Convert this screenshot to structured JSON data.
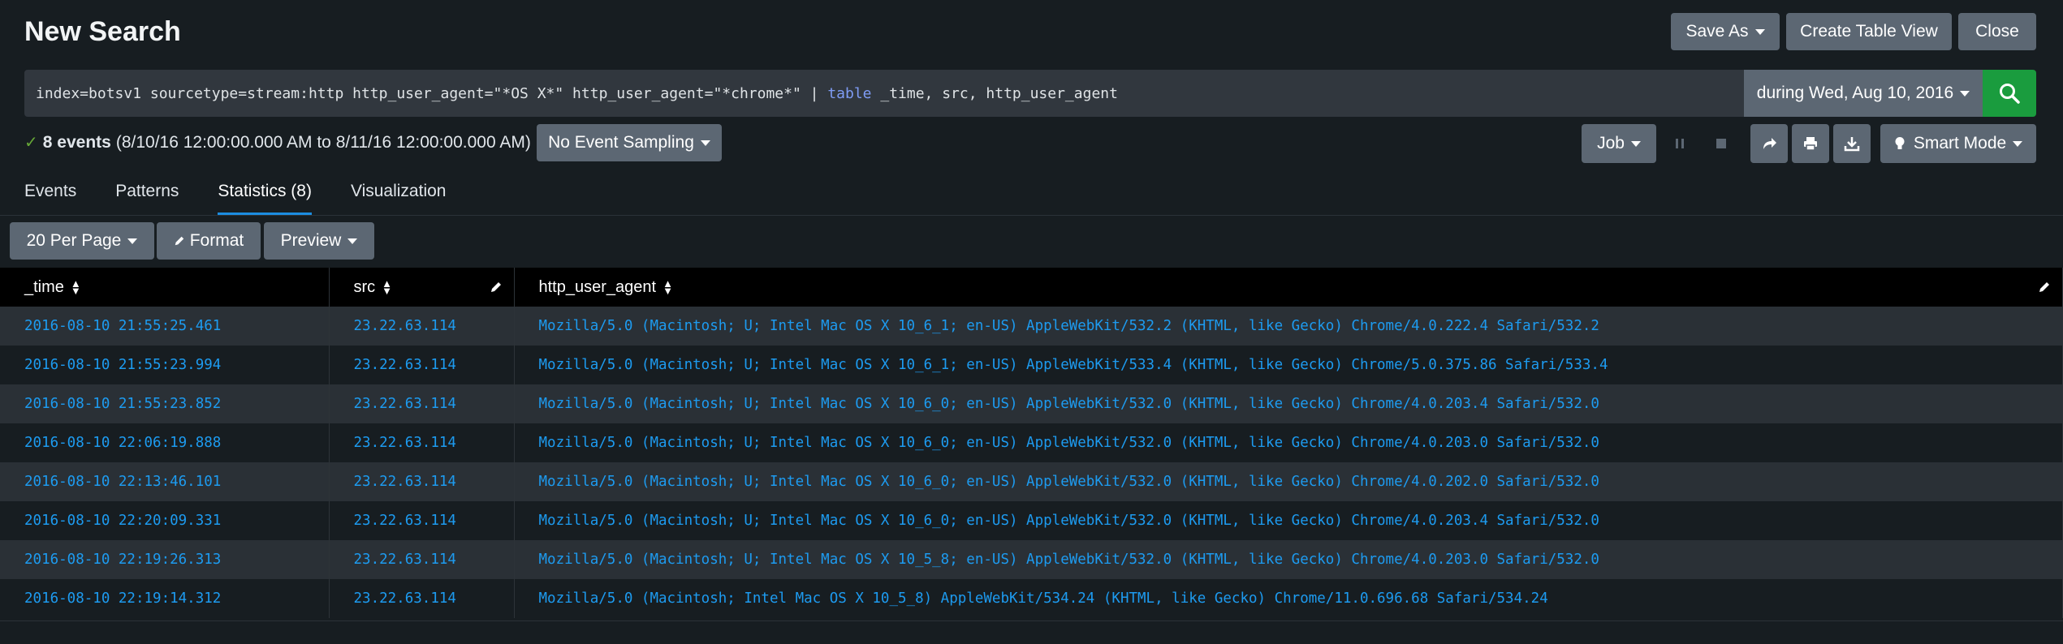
{
  "header": {
    "title": "New Search",
    "save_as_label": "Save As",
    "create_table_view_label": "Create Table View",
    "close_label": "Close"
  },
  "search": {
    "query_prefix": "index=botsv1 sourcetype=stream:http http_user_agent=\"*OS X*\" http_user_agent=\"*chrome*\" | ",
    "query_command": "table",
    "query_suffix": " _time, src, http_user_agent",
    "time_range_label": "during Wed, Aug 10, 2016"
  },
  "status": {
    "events_count": "8 events",
    "events_range": "(8/10/16 12:00:00.000 AM to 8/11/16 12:00:00.000 AM)",
    "sampling_label": "No Event Sampling",
    "job_label": "Job",
    "mode_label": "Smart Mode"
  },
  "tabs": [
    {
      "label": "Events",
      "active": false
    },
    {
      "label": "Patterns",
      "active": false
    },
    {
      "label": "Statistics (8)",
      "active": true
    },
    {
      "label": "Visualization",
      "active": false
    }
  ],
  "toolbar": {
    "per_page_label": "20 Per Page",
    "format_label": "Format",
    "preview_label": "Preview"
  },
  "table": {
    "columns": [
      "_time",
      "src",
      "http_user_agent"
    ],
    "rows": [
      [
        "2016-08-10 21:55:25.461",
        "23.22.63.114",
        "Mozilla/5.0 (Macintosh; U; Intel Mac OS X 10_6_1; en-US) AppleWebKit/532.2 (KHTML, like Gecko) Chrome/4.0.222.4 Safari/532.2"
      ],
      [
        "2016-08-10 21:55:23.994",
        "23.22.63.114",
        "Mozilla/5.0 (Macintosh; U; Intel Mac OS X 10_6_1; en-US) AppleWebKit/533.4 (KHTML, like Gecko) Chrome/5.0.375.86 Safari/533.4"
      ],
      [
        "2016-08-10 21:55:23.852",
        "23.22.63.114",
        "Mozilla/5.0 (Macintosh; U; Intel Mac OS X 10_6_0; en-US) AppleWebKit/532.0 (KHTML, like Gecko) Chrome/4.0.203.4 Safari/532.0"
      ],
      [
        "2016-08-10 22:06:19.888",
        "23.22.63.114",
        "Mozilla/5.0 (Macintosh; U; Intel Mac OS X 10_6_0; en-US) AppleWebKit/532.0 (KHTML, like Gecko) Chrome/4.0.203.0 Safari/532.0"
      ],
      [
        "2016-08-10 22:13:46.101",
        "23.22.63.114",
        "Mozilla/5.0 (Macintosh; U; Intel Mac OS X 10_6_0; en-US) AppleWebKit/532.0 (KHTML, like Gecko) Chrome/4.0.202.0 Safari/532.0"
      ],
      [
        "2016-08-10 22:20:09.331",
        "23.22.63.114",
        "Mozilla/5.0 (Macintosh; U; Intel Mac OS X 10_6_0; en-US) AppleWebKit/532.0 (KHTML, like Gecko) Chrome/4.0.203.4 Safari/532.0"
      ],
      [
        "2016-08-10 22:19:26.313",
        "23.22.63.114",
        "Mozilla/5.0 (Macintosh; U; Intel Mac OS X 10_5_8; en-US) AppleWebKit/532.0 (KHTML, like Gecko) Chrome/4.0.203.0 Safari/532.0"
      ],
      [
        "2016-08-10 22:19:14.312",
        "23.22.63.114",
        "Mozilla/5.0 (Macintosh; Intel Mac OS X 10_5_8) AppleWebKit/534.24 (KHTML, like Gecko) Chrome/11.0.696.68 Safari/534.24"
      ]
    ]
  },
  "colors": {
    "accent_blue": "#1c8de0",
    "link_blue": "#1d9bf0",
    "search_green": "#1a9c3e",
    "button_gray": "#5c6773"
  },
  "icons": {
    "search": "magnifier-icon",
    "check": "checkmark-icon",
    "pause": "pause-icon",
    "stop": "stop-icon",
    "share": "share-arrow-icon",
    "print": "printer-icon",
    "export": "download-icon",
    "mode": "lightbulb-icon",
    "edit": "pencil-icon",
    "sort": "sort-arrows-icon"
  }
}
